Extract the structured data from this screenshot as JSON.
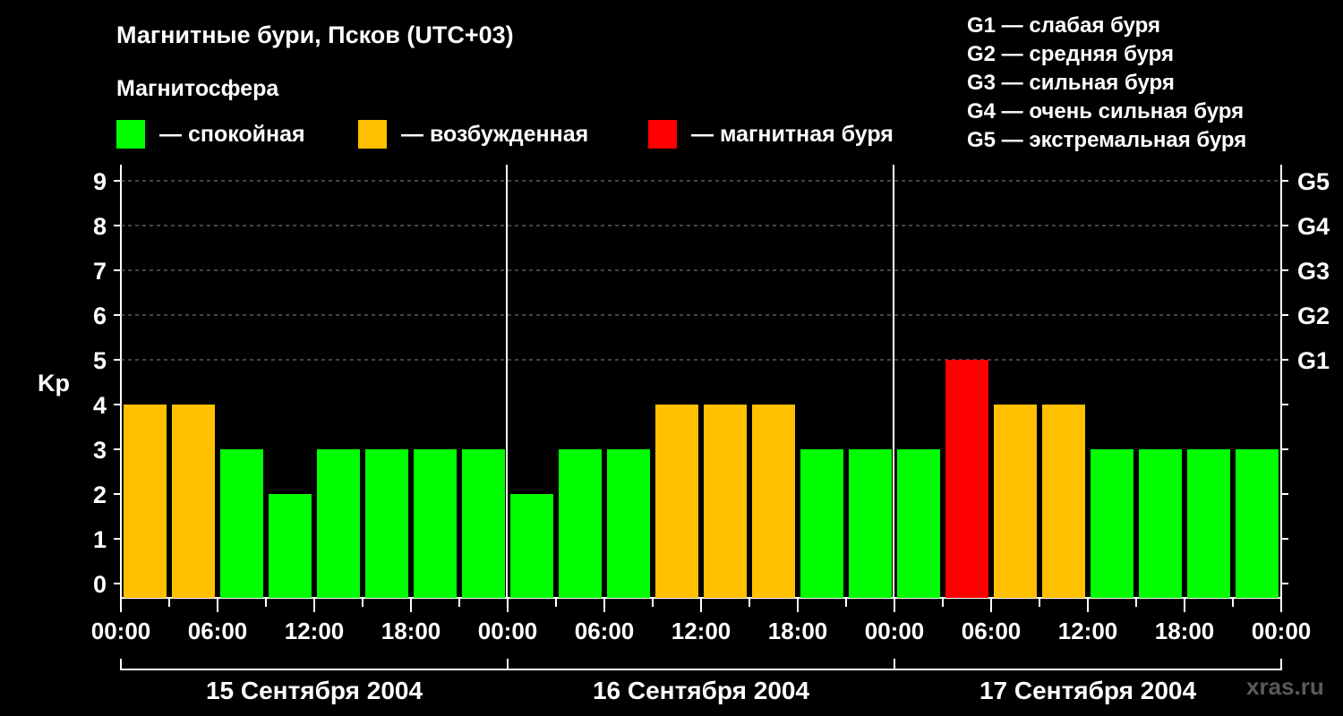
{
  "title": "Магнитные бури, Псков (UTC+03)",
  "subtitle": "Магнитосфера",
  "legend": [
    {
      "color": "#00ff00",
      "label": "— спокойная"
    },
    {
      "color": "#ffc000",
      "label": "— возбужденная"
    },
    {
      "color": "#ff0000",
      "label": "— магнитная буря"
    }
  ],
  "g_scale": [
    "G1 — слабая буря",
    "G2 — средняя буря",
    "G3 — сильная буря",
    "G4 — очень сильная буря",
    "G5 — экстремальная буря"
  ],
  "watermark": "xras.ru",
  "chart_data": {
    "type": "bar",
    "ylabel": "Kp",
    "ylim": [
      0,
      9
    ],
    "yticks": [
      0,
      1,
      2,
      3,
      4,
      5,
      6,
      7,
      8,
      9
    ],
    "right_axis": [
      {
        "kp": 5,
        "label": "G1"
      },
      {
        "kp": 6,
        "label": "G2"
      },
      {
        "kp": 7,
        "label": "G3"
      },
      {
        "kp": 8,
        "label": "G4"
      },
      {
        "kp": 9,
        "label": "G5"
      }
    ],
    "grid": "dashed horizontal",
    "x_tick_labels": [
      "00:00",
      "06:00",
      "12:00",
      "18:00",
      "00:00",
      "06:00",
      "12:00",
      "18:00",
      "00:00",
      "06:00",
      "12:00",
      "18:00",
      "00:00"
    ],
    "days": [
      "15 Сентября 2004",
      "16 Сентября 2004",
      "17 Сентября 2004"
    ],
    "intervals_per_day": 8,
    "series": [
      {
        "values": [
          4,
          4,
          3,
          2,
          3,
          3,
          3,
          3,
          2,
          3,
          3,
          4,
          4,
          4,
          3,
          3,
          3,
          5,
          4,
          4,
          3,
          3,
          3,
          3
        ]
      }
    ],
    "colors": {
      "quiet": "#00ff00",
      "active": "#ffc000",
      "storm": "#ff0000"
    }
  }
}
